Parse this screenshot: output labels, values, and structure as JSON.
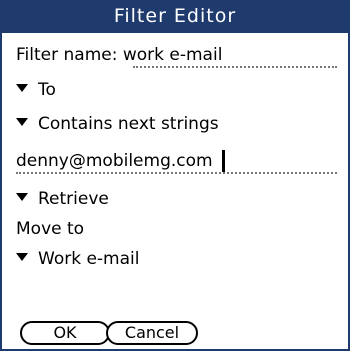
{
  "window": {
    "title": "Filter Editor"
  },
  "filter_name": {
    "label": "Filter name:",
    "value": "work e-mail"
  },
  "field_picker": {
    "value": "To"
  },
  "condition_picker": {
    "value": "Contains next strings"
  },
  "match_string": {
    "value": "denny@mobilemg.com"
  },
  "action_picker": {
    "value": "Retrieve"
  },
  "move_to": {
    "label": "Move to",
    "folder": "Work e-mail"
  },
  "buttons": {
    "ok": "OK",
    "cancel": "Cancel"
  }
}
